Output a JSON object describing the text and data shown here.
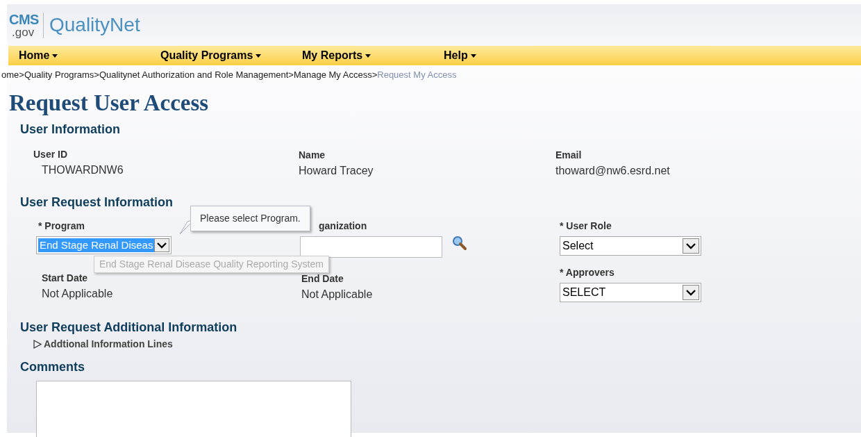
{
  "logo": {
    "top": "CMS",
    "bottom": ".gov",
    "product": "QualityNet"
  },
  "nav": [
    {
      "label": "Home"
    },
    {
      "label": "Quality Programs"
    },
    {
      "label": "My Reports"
    },
    {
      "label": "Help"
    }
  ],
  "breadcrumb": [
    {
      "text": "ome>",
      "current": false
    },
    {
      "text": "Quality Programs>",
      "current": false
    },
    {
      "text": "Qualitynet Authorization and Role Management>",
      "current": false
    },
    {
      "text": "Manage My Access>",
      "current": false
    },
    {
      "text": "Request My Access",
      "current": true
    }
  ],
  "page_title": "Request User Access",
  "user_information": {
    "heading": "User Information",
    "fields": [
      {
        "label": "User ID",
        "value": "THOWARDNW6"
      },
      {
        "label": "Name",
        "value": "Howard Tracey"
      },
      {
        "label": "Email",
        "value": "thoward@nw6.esrd.net"
      }
    ]
  },
  "user_request": {
    "heading": "User Request Information",
    "program": {
      "label": "* Program",
      "value": "End Stage Renal Diseas",
      "highlighted": true
    },
    "organization": {
      "label": "ganization"
    },
    "user_role": {
      "label": "* User Role",
      "value": "Select"
    },
    "start_date": {
      "label": "Start Date",
      "value": "Not Applicable"
    },
    "end_date": {
      "label": "End Date",
      "value": "Not Applicable"
    },
    "approvers": {
      "label": "* Approvers",
      "value": "SELECT"
    },
    "validation_tooltip": "Please select Program.",
    "hover_tooltip": "End Stage Renal Disease Quality Reporting System"
  },
  "additional": {
    "heading": "User Request Additional Information",
    "toggle": {
      "label": "Addtional Information Lines",
      "expanded": false
    }
  },
  "comments": {
    "heading": "Comments"
  }
}
